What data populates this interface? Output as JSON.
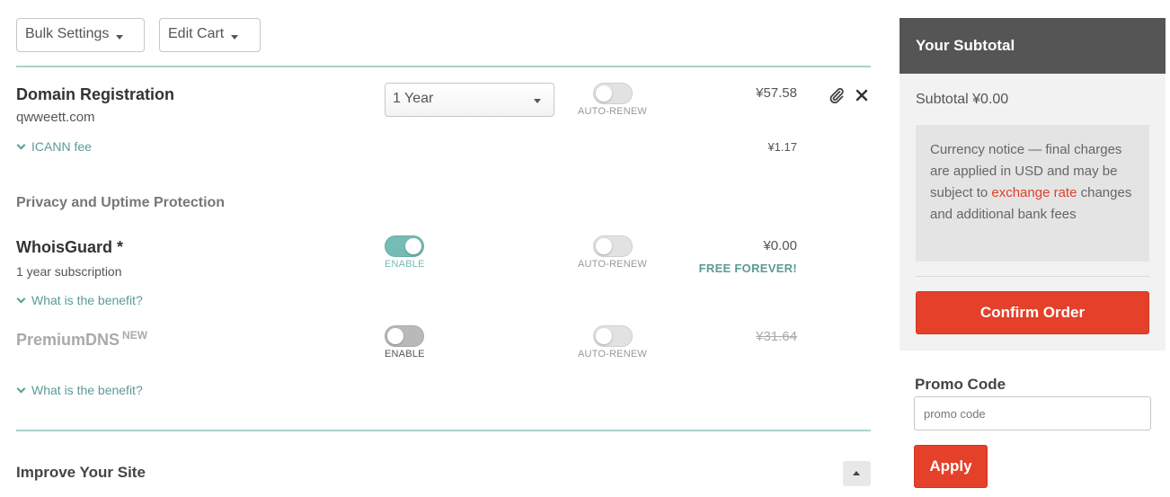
{
  "toolbar": {
    "bulk_settings": "Bulk Settings",
    "edit_cart": "Edit Cart"
  },
  "domain": {
    "title": "Domain Registration",
    "name": "qwweett.com",
    "term_selected": "1 Year",
    "auto_renew_label": "AUTO-RENEW",
    "auto_renew_on": false,
    "price": "¥57.58",
    "icann_fee_label": "ICANN fee",
    "icann_fee_price": "¥1.17"
  },
  "privacy": {
    "section_title": "Privacy and Uptime Protection",
    "whoisguard": {
      "title": "WhoisGuard *",
      "subtitle": "1 year subscription",
      "enable_label": "ENABLE",
      "enabled": true,
      "auto_renew_label": "AUTO-RENEW",
      "price": "¥0.00",
      "free_label": "FREE FOREVER!",
      "benefit_link": "What is the benefit?"
    },
    "premiumdns": {
      "title": "PremiumDNS",
      "badge": "NEW",
      "enable_label": "ENABLE",
      "enabled": false,
      "auto_renew_label": "AUTO-RENEW",
      "price": "¥31.64",
      "benefit_link": "What is the benefit?"
    }
  },
  "improve": {
    "title": "Improve Your Site"
  },
  "summary": {
    "header": "Your Subtotal",
    "subtotal": "Subtotal ¥0.00",
    "notice_pre": "Currency notice — final charges are applied in USD and may be subject to ",
    "notice_link": "exchange rate",
    "notice_post": " changes and additional bank fees",
    "confirm_label": "Confirm Order"
  },
  "promo": {
    "label": "Promo Code",
    "placeholder": "promo code",
    "apply_label": "Apply"
  },
  "colors": {
    "accent_red": "#e4402a",
    "teal": "#74bcb4",
    "header_gray": "#555555"
  }
}
